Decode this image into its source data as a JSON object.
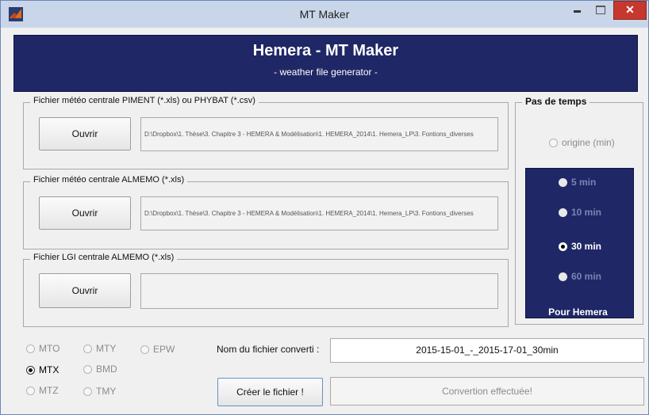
{
  "window": {
    "title": "MT Maker",
    "close_glyph": "✕"
  },
  "header": {
    "title": "Hemera - MT Maker",
    "subtitle": "- weather file generator -"
  },
  "sections": [
    {
      "legend": "Fichier météo centrale PIMENT (*.xls) ou PHYBAT (*.csv)",
      "button": "Ouvrir",
      "path": "D:\\Dropbox\\1. Thèse\\3. Chapitre 3 - HEMERA & Modélisation\\1. HEMERA_2014\\1. Hemera_LP\\3. Fontions_diverses"
    },
    {
      "legend": "Fichier météo centrale ALMEMO (*.xls)",
      "button": "Ouvrir",
      "path": "D:\\Dropbox\\1. Thèse\\3. Chapitre 3 - HEMERA & Modélisation\\1. HEMERA_2014\\1. Hemera_LP\\3. Fontions_diverses"
    },
    {
      "legend": "Fichier LGI centrale ALMEMO (*.xls)",
      "button": "Ouvrir",
      "path": ""
    }
  ],
  "pas_de_temps": {
    "legend": "Pas de temps",
    "origine": "origine (min)",
    "options": [
      "5 min",
      "10 min",
      "30 min",
      "60 min"
    ],
    "selected": "30 min",
    "footer": "Pour Hemera"
  },
  "formats": {
    "options": [
      "MTO",
      "MTY",
      "EPW",
      "MTX",
      "BMD",
      "MTZ",
      "TMY"
    ],
    "selected": "MTX"
  },
  "output": {
    "filename_label": "Nom du fichier converti :",
    "filename_value": "2015-15-01_-_2015-17-01_30min",
    "create_button": "Créer le fichier !",
    "status": "Convertion effectuée!"
  }
}
